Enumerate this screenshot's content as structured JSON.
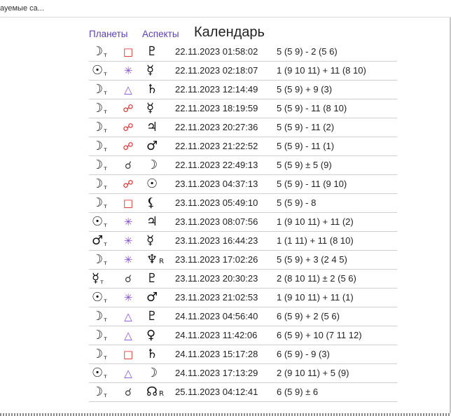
{
  "browser": {
    "bookmark_text": "доступные сайты",
    "bookmark_visible": "ауемые са..."
  },
  "nav": {
    "planets": "Планеты",
    "aspects": "Аспекты",
    "title": "Календарь"
  },
  "aspect_colors": {
    "square": "#e02020",
    "sextile": "#8a4fd8",
    "trine": "#8a4fd8",
    "opposition": "#e02020",
    "conjunction": "#444444"
  },
  "aspect_glyphs": {
    "square": "□",
    "sextile": "✳",
    "trine": "△",
    "opposition": "☍",
    "conjunction": "☌"
  },
  "rows": [
    {
      "p1": "☽",
      "p1_sub": "т",
      "aspect": "square",
      "p2": "♇",
      "p2_r": "",
      "datetime": "22.11.2023 01:58:02",
      "houses": "5 (5 9) - 2 (5 6)"
    },
    {
      "p1": "☉",
      "p1_sub": "т",
      "aspect": "sextile",
      "p2": "☿",
      "p2_r": "",
      "datetime": "22.11.2023 02:18:07",
      "houses": "1 (9 10 11) + 11 (8 10)"
    },
    {
      "p1": "☽",
      "p1_sub": "т",
      "aspect": "trine",
      "p2": "♄",
      "p2_r": "",
      "datetime": "22.11.2023 12:14:49",
      "houses": "5 (5 9) + 9 (3)"
    },
    {
      "p1": "☽",
      "p1_sub": "т",
      "aspect": "opposition",
      "p2": "☿",
      "p2_r": "",
      "datetime": "22.11.2023 18:19:59",
      "houses": "5 (5 9) - 11 (8 10)"
    },
    {
      "p1": "☽",
      "p1_sub": "т",
      "aspect": "opposition",
      "p2": "♃",
      "p2_r": "",
      "datetime": "22.11.2023 20:27:36",
      "houses": "5 (5 9) - 11 (2)"
    },
    {
      "p1": "☽",
      "p1_sub": "т",
      "aspect": "opposition",
      "p2": "♂",
      "p2_r": "",
      "datetime": "22.11.2023 21:22:52",
      "houses": "5 (5 9) - 11 (1)"
    },
    {
      "p1": "☽",
      "p1_sub": "т",
      "aspect": "conjunction",
      "p2": "☽",
      "p2_r": "",
      "datetime": "22.11.2023 22:49:13",
      "houses": "5 (5 9) ± 5 (9)"
    },
    {
      "p1": "☽",
      "p1_sub": "т",
      "aspect": "opposition",
      "p2": "☉",
      "p2_r": "",
      "datetime": "23.11.2023 04:37:13",
      "houses": "5 (5 9) - 11 (9 10)"
    },
    {
      "p1": "☽",
      "p1_sub": "т",
      "aspect": "square",
      "p2": "⚸",
      "p2_r": "",
      "datetime": "23.11.2023 05:49:10",
      "houses": "5 (5 9) - 8"
    },
    {
      "p1": "☉",
      "p1_sub": "т",
      "aspect": "sextile",
      "p2": "♃",
      "p2_r": "",
      "datetime": "23.11.2023 08:07:56",
      "houses": "1 (9 10 11) + 11 (2)"
    },
    {
      "p1": "♂",
      "p1_sub": "т",
      "aspect": "sextile",
      "p2": "☿",
      "p2_r": "",
      "datetime": "23.11.2023 16:44:23",
      "houses": "1 (1 11) + 11 (8 10)"
    },
    {
      "p1": "☽",
      "p1_sub": "т",
      "aspect": "sextile",
      "p2": "♆",
      "p2_r": "R",
      "datetime": "23.11.2023 17:02:26",
      "houses": "5 (5 9) + 3 (2 4 5)"
    },
    {
      "p1": "☿",
      "p1_sub": "т",
      "aspect": "conjunction",
      "p2": "♇",
      "p2_r": "",
      "datetime": "23.11.2023 20:30:23",
      "houses": "2 (8 10 11) ± 2 (5 6)"
    },
    {
      "p1": "☉",
      "p1_sub": "т",
      "aspect": "sextile",
      "p2": "♂",
      "p2_r": "",
      "datetime": "23.11.2023 21:02:53",
      "houses": "1 (9 10 11) + 11 (1)"
    },
    {
      "p1": "☽",
      "p1_sub": "т",
      "aspect": "trine",
      "p2": "♇",
      "p2_r": "",
      "datetime": "24.11.2023 04:56:40",
      "houses": "6 (5 9) + 2 (5 6)"
    },
    {
      "p1": "☽",
      "p1_sub": "т",
      "aspect": "trine",
      "p2": "♀",
      "p2_r": "",
      "datetime": "24.11.2023 11:42:06",
      "houses": "6 (5 9) + 10 (7 11 12)"
    },
    {
      "p1": "☽",
      "p1_sub": "т",
      "aspect": "square",
      "p2": "♄",
      "p2_r": "",
      "datetime": "24.11.2023 15:17:28",
      "houses": "6 (5 9) - 9 (3)"
    },
    {
      "p1": "☉",
      "p1_sub": "т",
      "aspect": "trine",
      "p2": "☽",
      "p2_r": "",
      "datetime": "24.11.2023 17:13:29",
      "houses": "2 (9 10 11) + 5 (9)"
    },
    {
      "p1": "☽",
      "p1_sub": "т",
      "aspect": "conjunction",
      "p2": "☊",
      "p2_r": "R",
      "datetime": "25.11.2023 04:12:41",
      "houses": "6 (5 9) ± 6"
    }
  ]
}
